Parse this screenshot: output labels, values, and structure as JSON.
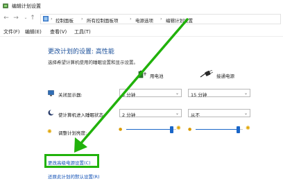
{
  "window": {
    "title": "编辑计划设置"
  },
  "nav": {
    "back": "←",
    "forward": "→",
    "up": "↑"
  },
  "address": {
    "crumbs": [
      "控制面板",
      "所有控制面板项",
      "电源选项",
      "编辑计划设置"
    ],
    "separator": "›"
  },
  "menu": {
    "items": [
      "文件(F)",
      "编辑(E)",
      "查看(V)",
      "工具(T)"
    ]
  },
  "content": {
    "heading": "更改计划的设置: 高性能",
    "subheading": "选择希望计算机使用的睡眠设置和显示设置。",
    "columns": {
      "battery": "用电池",
      "plugged": "接通电源"
    },
    "rows": {
      "display_off": {
        "label": "关闭显示器:",
        "battery": "5 分钟",
        "plugged": "15 分钟"
      },
      "sleep": {
        "label": "使计算机进入睡眠状态:",
        "battery": "2 分钟",
        "plugged": "从不"
      },
      "brightness": {
        "label": "调整计划亮度:",
        "battery_level": 0.9,
        "plugged_level": 0.9
      }
    },
    "links": {
      "advanced": "更改高级电源设置(C)",
      "restore": "还原此计划的默认设置(R)"
    }
  },
  "icons": {
    "window": "power-options-icon",
    "battery_column": "battery-plug-icon",
    "plugged_column": "power-plug-icon",
    "display": "monitor-icon",
    "sleep": "moon-icon",
    "brightness": "sun-icon"
  },
  "colors": {
    "heading": "#1a4f9a",
    "link": "#0f4fb5",
    "slider": "#1a66c8",
    "annotation": "#21b20b"
  }
}
